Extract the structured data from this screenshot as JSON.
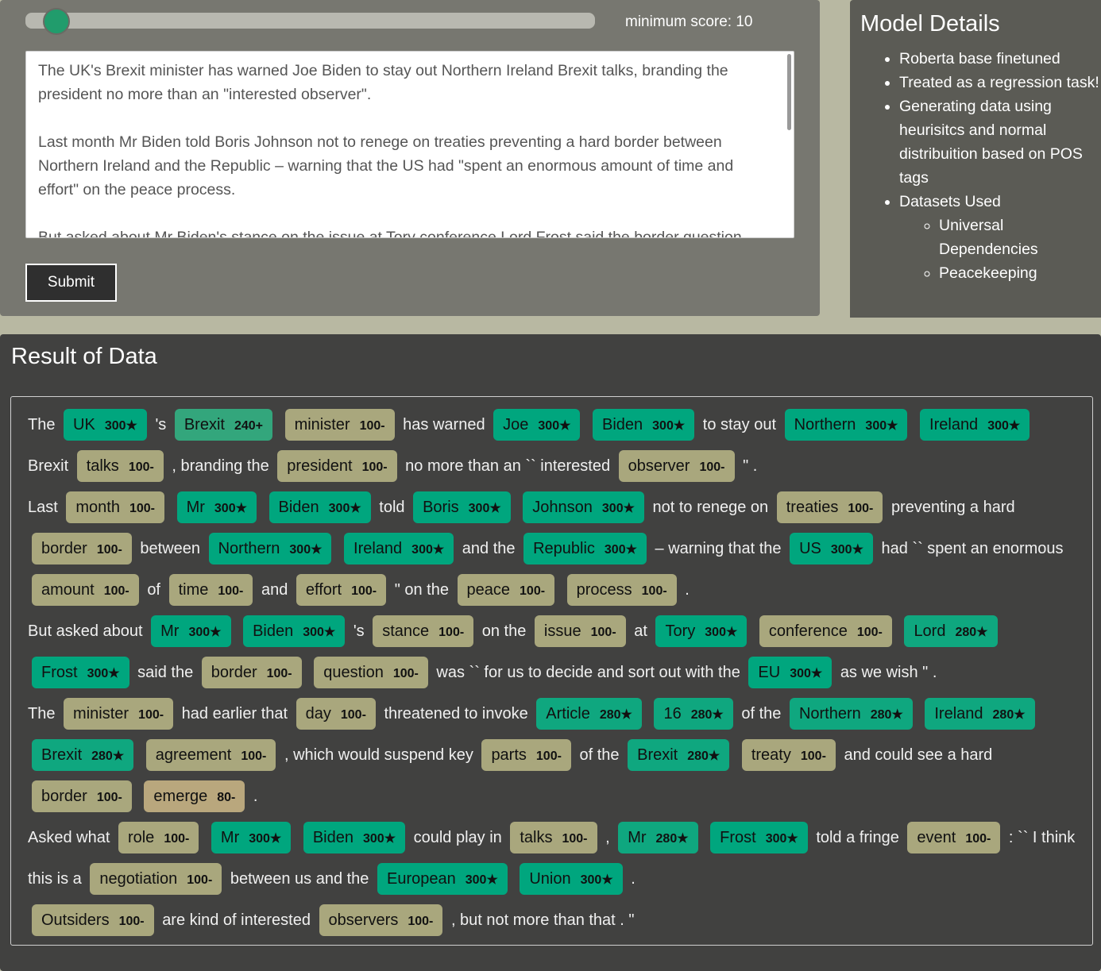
{
  "controls": {
    "min_score_label": "minimum score: 10",
    "min_score_value": 10,
    "textarea_value": "The UK's Brexit minister has warned Joe Biden to stay out Northern Ireland Brexit talks, branding the president no more than an \"interested observer\".\n\nLast month Mr Biden told Boris Johnson not to renege on treaties preventing a hard border between Northern Ireland and the Republic – warning that the US had \"spent an enormous amount of time and effort\" on the peace process.\n\nBut asked about Mr Biden's stance on the issue at Tory conference Lord Frost said the border question",
    "submit_label": "Submit",
    "accent": "#219c6c"
  },
  "model_details": {
    "title": "Model Details",
    "items": [
      "Roberta base finetuned",
      "Treated as a regression task!",
      "Generating data using heurisitcs and normal distribuition based on POS tags",
      "Datasets Used"
    ],
    "datasets": [
      "Universal Dependencies",
      "Peacekeeping"
    ]
  },
  "result": {
    "title": "Result of Data",
    "colors": {
      "300": "#00a67e",
      "280": "#0fa77f",
      "240": "#33a67c",
      "100": "#a9a77d",
      "80": "#b9a77d"
    },
    "paragraphs": [
      [
        " The ",
        {
          "w": "UK",
          "s": "300★"
        },
        "'s",
        {
          "w": "Brexit",
          "s": "240+"
        },
        {
          "w": "minister",
          "s": "100-"
        },
        "has warned",
        {
          "w": "Joe",
          "s": "300★"
        },
        {
          "w": "Biden",
          "s": "300★"
        },
        "to stay out",
        {
          "w": "Northern",
          "s": "300★"
        },
        {
          "w": "Ireland",
          "s": "300★"
        },
        "Brexit",
        {
          "w": "talks",
          "s": "100-"
        },
        ", branding the",
        {
          "w": "president",
          "s": "100-"
        },
        "no more than an `` interested",
        {
          "w": "observer",
          "s": "100-"
        },
        "\" ."
      ],
      [
        "Last",
        {
          "w": "month",
          "s": "100-"
        },
        {
          "w": "Mr",
          "s": "300★"
        },
        {
          "w": "Biden",
          "s": "300★"
        },
        "told",
        {
          "w": "Boris",
          "s": "300★"
        },
        {
          "w": "Johnson",
          "s": "300★"
        },
        "not to renege on",
        {
          "w": "treaties",
          "s": "100-"
        },
        "preventing a hard",
        {
          "w": "border",
          "s": "100-"
        },
        "between",
        {
          "w": "Northern",
          "s": "300★"
        },
        {
          "w": "Ireland",
          "s": "300★"
        },
        "and the",
        {
          "w": "Republic",
          "s": "300★"
        },
        "– warning that the",
        {
          "w": "US",
          "s": "300★"
        },
        "had `` spent an enormous",
        {
          "w": "amount",
          "s": "100-"
        },
        "of",
        {
          "w": "time",
          "s": "100-"
        },
        "and",
        {
          "w": "effort",
          "s": "100-"
        },
        "\" on the",
        {
          "w": "peace",
          "s": "100-"
        },
        {
          "w": "process",
          "s": "100-"
        },
        "."
      ],
      [
        "But asked about",
        {
          "w": "Mr",
          "s": "300★"
        },
        {
          "w": "Biden",
          "s": "300★"
        },
        "'s",
        {
          "w": "stance",
          "s": "100-"
        },
        "on the",
        {
          "w": "issue",
          "s": "100-"
        },
        "at",
        {
          "w": "Tory",
          "s": "300★"
        },
        {
          "w": "conference",
          "s": "100-"
        },
        {
          "w": "Lord",
          "s": "280★"
        },
        {
          "w": "Frost",
          "s": "300★"
        },
        "said the",
        {
          "w": "border",
          "s": "100-"
        },
        {
          "w": "question",
          "s": "100-"
        },
        "was `` for us to decide and sort out with the",
        {
          "w": "EU",
          "s": "300★"
        },
        "as we wish \" ."
      ],
      [
        "The",
        {
          "w": "minister",
          "s": "100-"
        },
        "had earlier that",
        {
          "w": "day",
          "s": "100-"
        },
        "threatened to invoke",
        {
          "w": "Article",
          "s": "280★"
        },
        {
          "w": "16",
          "s": "280★"
        },
        "of the",
        {
          "w": "Northern",
          "s": "280★"
        },
        {
          "w": "Ireland",
          "s": "280★"
        },
        {
          "w": "Brexit",
          "s": "280★"
        },
        {
          "w": "agreement",
          "s": "100-"
        },
        ", which would suspend key",
        {
          "w": "parts",
          "s": "100-"
        },
        "of the",
        {
          "w": "Brexit",
          "s": "280★"
        },
        {
          "w": "treaty",
          "s": "100-"
        },
        "and could see a hard",
        {
          "w": "border",
          "s": "100-"
        },
        {
          "w": "emerge",
          "s": "80-"
        },
        "."
      ],
      [
        "Asked what",
        {
          "w": "role",
          "s": "100-"
        },
        {
          "w": "Mr",
          "s": "300★"
        },
        {
          "w": "Biden",
          "s": "300★"
        },
        "could play in",
        {
          "w": "talks",
          "s": "100-"
        },
        ",",
        {
          "w": "Mr",
          "s": "280★"
        },
        {
          "w": "Frost",
          "s": "300★"
        },
        "told a fringe",
        {
          "w": "event",
          "s": "100-"
        },
        ": `` I think this is a",
        {
          "w": "negotiation",
          "s": "100-"
        },
        "between us and the",
        {
          "w": "European",
          "s": "300★"
        },
        {
          "w": "Union",
          "s": "300★"
        },
        "."
      ],
      [
        {
          "w": "Outsiders",
          "s": "100-"
        },
        "are kind of interested",
        {
          "w": "observers",
          "s": "100-"
        },
        ", but not more than that . \""
      ]
    ]
  }
}
